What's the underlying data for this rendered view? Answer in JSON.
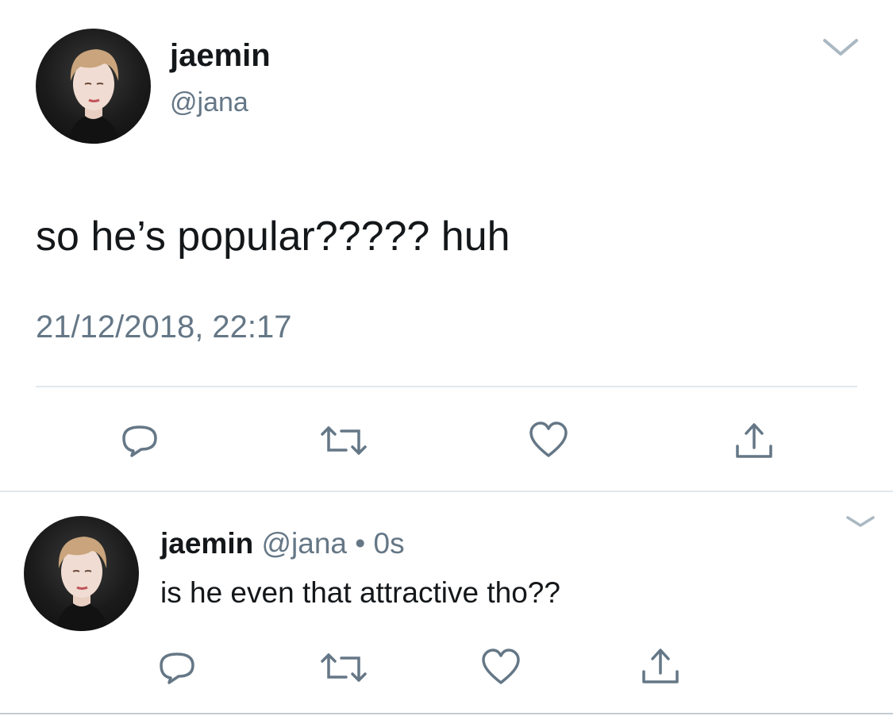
{
  "main_tweet": {
    "avatar": "profile-photo",
    "display_name": "jaemin",
    "handle": "@jana",
    "text": "so he’s popular????? huh",
    "timestamp": "21/12/2018, 22:17",
    "actions": [
      "reply-icon",
      "retweet-icon",
      "like-icon",
      "share-icon"
    ],
    "menu_icon": "chevron-down-icon"
  },
  "reply_tweet": {
    "avatar": "profile-photo",
    "display_name": "jaemin",
    "handle": "@jana",
    "separator": "•",
    "time": "0s",
    "text": "is he even that attractive tho??",
    "actions": [
      "reply-icon",
      "retweet-icon",
      "like-icon",
      "share-icon"
    ],
    "menu_icon": "chevron-down-icon"
  },
  "colors": {
    "text_primary": "#14171a",
    "text_secondary": "#657786",
    "divider": "#e1e8ed"
  }
}
